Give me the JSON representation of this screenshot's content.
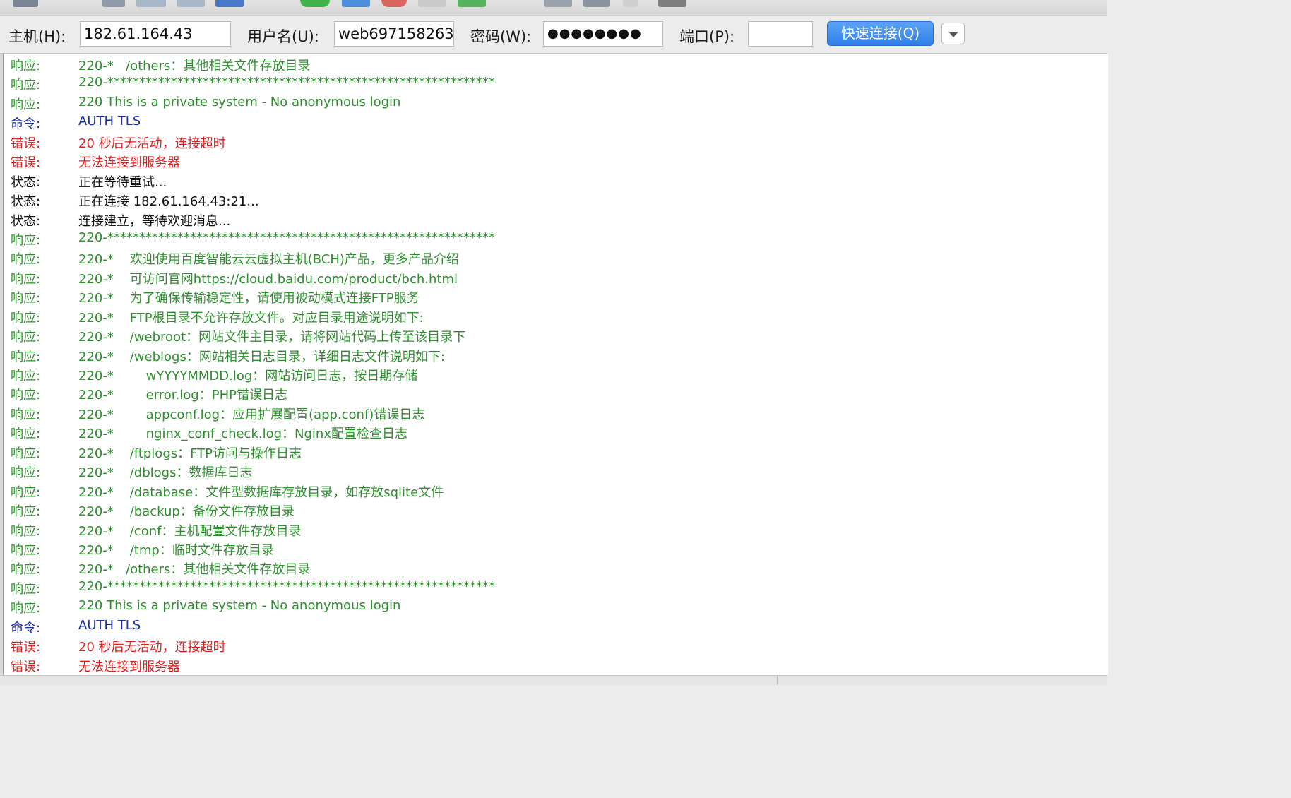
{
  "quickconnect": {
    "host_label": "主机(H):",
    "host_value": "182.61.164.43",
    "user_label": "用户名(U):",
    "user_value": "web697158263",
    "pass_label": "密码(W):",
    "pass_value": "●●●●●●●●",
    "port_label": "端口(P):",
    "port_value": "",
    "connect_label": "快速连接(Q)"
  },
  "colors": {
    "response": "#2d8f2d",
    "command": "#1c2fa3",
    "error": "#e02020",
    "status": "#111111",
    "accent": "#3b8af0"
  },
  "log": [
    {
      "type": "response",
      "label": "响应:",
      "text": "220-*   /others：其他相关文件存放目录"
    },
    {
      "type": "response",
      "label": "响应:",
      "text": "220-*************************************************************"
    },
    {
      "type": "response",
      "label": "响应:",
      "text": "220 This is a private system - No anonymous login"
    },
    {
      "type": "command",
      "label": "命令:",
      "text": "AUTH TLS"
    },
    {
      "type": "error",
      "label": "错误:",
      "text": "20 秒后无活动，连接超时"
    },
    {
      "type": "error",
      "label": "错误:",
      "text": "无法连接到服务器"
    },
    {
      "type": "status",
      "label": "状态:",
      "text": "正在等待重试..."
    },
    {
      "type": "status",
      "label": "状态:",
      "text": "正在连接 182.61.164.43:21..."
    },
    {
      "type": "status",
      "label": "状态:",
      "text": "连接建立，等待欢迎消息..."
    },
    {
      "type": "response",
      "label": "响应:",
      "text": "220-*************************************************************"
    },
    {
      "type": "response",
      "label": "响应:",
      "text": "220-*    欢迎使用百度智能云云虚拟主机(BCH)产品，更多产品介绍"
    },
    {
      "type": "response",
      "label": "响应:",
      "text": "220-*    可访问官网https://cloud.baidu.com/product/bch.html"
    },
    {
      "type": "response",
      "label": "响应:",
      "text": "220-*    为了确保传输稳定性，请使用被动模式连接FTP服务"
    },
    {
      "type": "response",
      "label": "响应:",
      "text": "220-*    FTP根目录不允许存放文件。对应目录用途说明如下:"
    },
    {
      "type": "response",
      "label": "响应:",
      "text": "220-*    /webroot：网站文件主目录，请将网站代码上传至该目录下"
    },
    {
      "type": "response",
      "label": "响应:",
      "text": "220-*    /weblogs：网站相关日志目录，详细日志文件说明如下:"
    },
    {
      "type": "response",
      "label": "响应:",
      "text": "220-*        wYYYYMMDD.log：网站访问日志，按日期存储"
    },
    {
      "type": "response",
      "label": "响应:",
      "text": "220-*        error.log：PHP错误日志"
    },
    {
      "type": "response",
      "label": "响应:",
      "text": "220-*        appconf.log：应用扩展配置(app.conf)错误日志"
    },
    {
      "type": "response",
      "label": "响应:",
      "text": "220-*        nginx_conf_check.log：Nginx配置检查日志"
    },
    {
      "type": "response",
      "label": "响应:",
      "text": "220-*    /ftplogs：FTP访问与操作日志"
    },
    {
      "type": "response",
      "label": "响应:",
      "text": "220-*    /dblogs：数据库日志"
    },
    {
      "type": "response",
      "label": "响应:",
      "text": "220-*    /database：文件型数据库存放目录，如存放sqlite文件"
    },
    {
      "type": "response",
      "label": "响应:",
      "text": "220-*    /backup：备份文件存放目录"
    },
    {
      "type": "response",
      "label": "响应:",
      "text": "220-*    /conf：主机配置文件存放目录"
    },
    {
      "type": "response",
      "label": "响应:",
      "text": "220-*    /tmp：临时文件存放目录"
    },
    {
      "type": "response",
      "label": "响应:",
      "text": "220-*   /others：其他相关文件存放目录"
    },
    {
      "type": "response",
      "label": "响应:",
      "text": "220-*************************************************************"
    },
    {
      "type": "response",
      "label": "响应:",
      "text": "220 This is a private system - No anonymous login"
    },
    {
      "type": "command",
      "label": "命令:",
      "text": "AUTH TLS"
    },
    {
      "type": "error",
      "label": "错误:",
      "text": "20 秒后无活动，连接超时"
    },
    {
      "type": "error",
      "label": "错误:",
      "text": "无法连接到服务器"
    }
  ]
}
